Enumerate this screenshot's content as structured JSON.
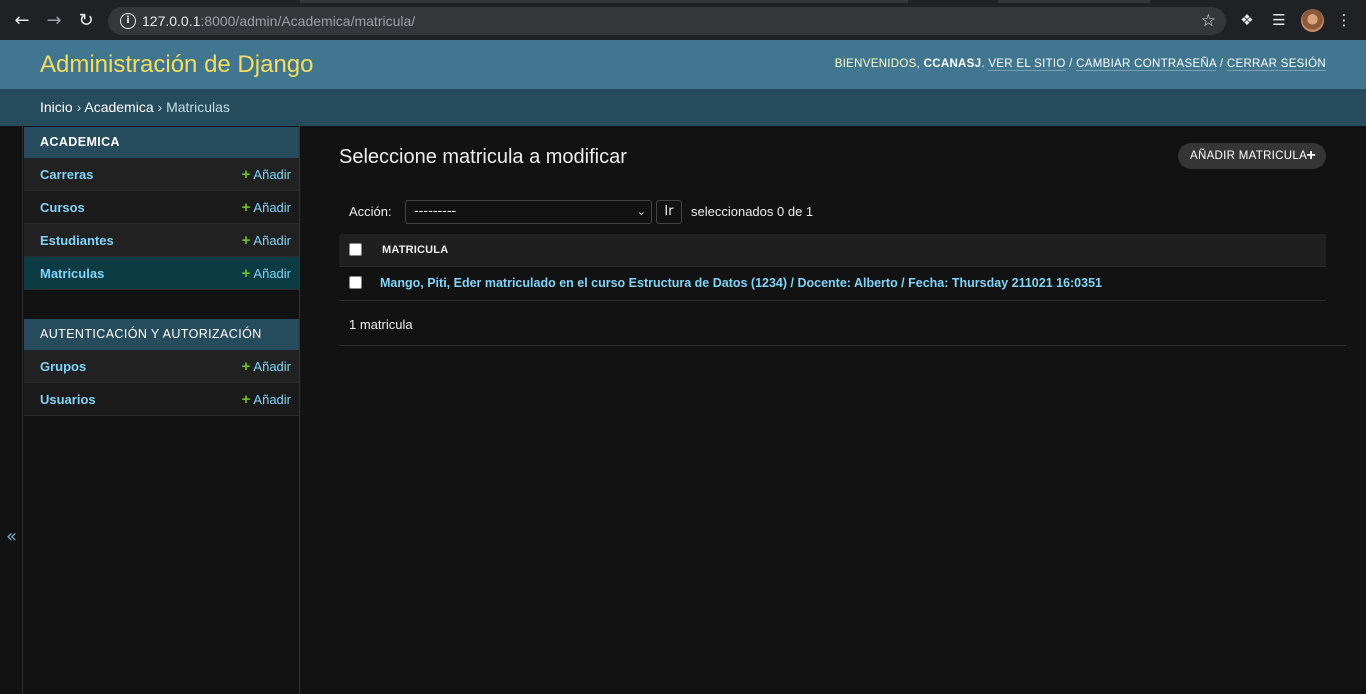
{
  "browser": {
    "url_host": "127.0.0.1",
    "url_rest": ":8000/admin/Academica/matricula/"
  },
  "header": {
    "site_name": "Administración de Django",
    "welcome": "BIENVENIDOS,",
    "username": "CCANASJ",
    "view_site": "VER EL SITIO",
    "change_password": "CAMBIAR CONTRASEÑA",
    "logout": "CERRAR SESIÓN"
  },
  "breadcrumbs": {
    "home": "Inicio",
    "app": "Academica",
    "current": "Matriculas"
  },
  "sidebar": {
    "toggle": "«",
    "modules": [
      {
        "caption": "ACADEMICA",
        "items": [
          {
            "label": "Carreras",
            "add": "Añadir"
          },
          {
            "label": "Cursos",
            "add": "Añadir"
          },
          {
            "label": "Estudiantes",
            "add": "Añadir"
          },
          {
            "label": "Matriculas",
            "add": "Añadir"
          }
        ]
      },
      {
        "caption": "AUTENTICACIÓN Y AUTORIZACIÓN",
        "items": [
          {
            "label": "Grupos",
            "add": "Añadir"
          },
          {
            "label": "Usuarios",
            "add": "Añadir"
          }
        ]
      }
    ]
  },
  "main": {
    "title": "Seleccione matricula a modificar",
    "add_button": "AÑADIR MATRICULA",
    "action_label": "Acción:",
    "action_selected": "---------",
    "go_button": "Ir",
    "selection_counter": "seleccionados 0 de 1",
    "table": {
      "column_header": "MATRICULA",
      "rows": [
        "Mango, Piti, Eder matriculado en el curso Estructura de Datos (1234) / Docente: Alberto / Fecha: Thursday 211021 16:0351"
      ]
    },
    "paginator": "1 matricula"
  }
}
